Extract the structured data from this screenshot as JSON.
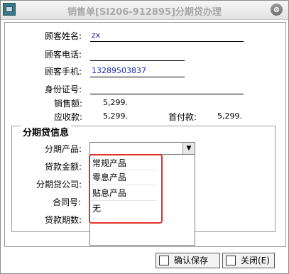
{
  "window": {
    "title": "销售单[SI206-912895]分期贷办理",
    "close_glyph": "⊗"
  },
  "customer": {
    "name_label": "顾客姓名:",
    "name_value": "zx",
    "phone_label": "顾客电话:",
    "phone_value": "",
    "mobile_label": "顾客手机:",
    "mobile_value": "13289503837",
    "id_label": "身份证号:",
    "id_value": ""
  },
  "amounts": {
    "sales_label": "销售额:",
    "sales_value": "5,299.",
    "receivable_label": "应收款:",
    "receivable_value": "5,299.",
    "down_label": "首付款:",
    "down_value": "5,299."
  },
  "installment": {
    "group_title": "分期贷信息",
    "product_label": "分期产品:",
    "loan_amount_label": "贷款金额:",
    "company_label": "分期贷公司:",
    "contract_label": "合同号:",
    "periods_label": "贷款期数:",
    "dropdown_options": [
      "常规产品",
      "零息产品",
      "贴息产品",
      "无"
    ]
  },
  "buttons": {
    "confirm_label": "确认保存",
    "close_label": "关闭(E)"
  }
}
